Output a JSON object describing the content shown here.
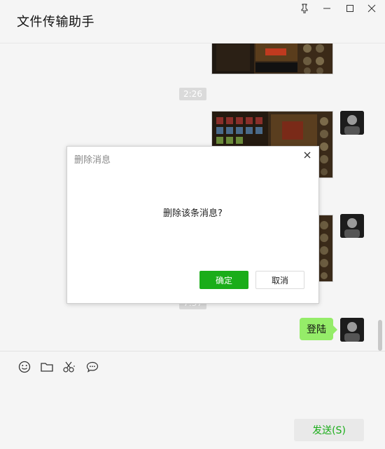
{
  "header": {
    "title": "文件传输助手"
  },
  "window_controls": [
    "pin-icon",
    "minimize-icon",
    "maximize-icon",
    "close-icon"
  ],
  "chat": {
    "timestamps": [
      "2:26",
      "7:37"
    ],
    "messages": [
      {
        "type": "image",
        "side": "right"
      },
      {
        "type": "image",
        "side": "right"
      },
      {
        "type": "image",
        "side": "right"
      },
      {
        "type": "text",
        "side": "right",
        "text": "登陆"
      }
    ]
  },
  "composer": {
    "tools": [
      "emoji-icon",
      "folder-icon",
      "scissors-icon",
      "chat-bubble-icon"
    ],
    "send_label": "发送(S)"
  },
  "dialog": {
    "title": "删除消息",
    "message": "删除该条消息?",
    "ok_label": "确定",
    "cancel_label": "取消"
  },
  "colors": {
    "accent": "#1aad19",
    "bubble": "#95ec69",
    "background": "#f5f5f5"
  }
}
